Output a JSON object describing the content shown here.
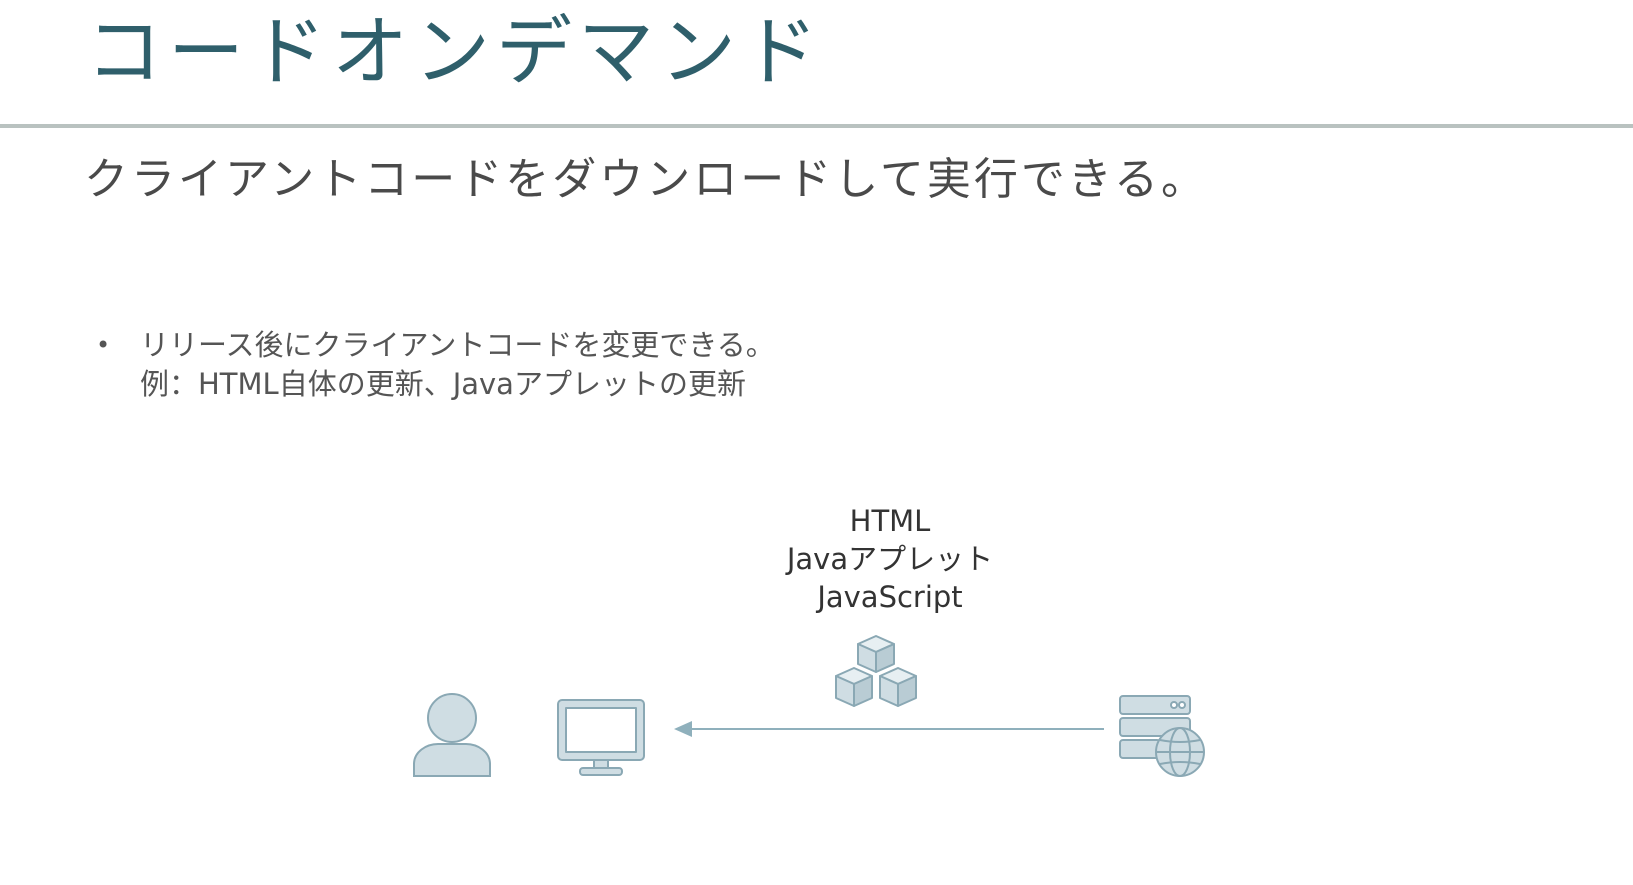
{
  "slide": {
    "title": "コードオンデマンド",
    "subtitle": "クライアントコードをダウンロードして実行できる。",
    "bullets": [
      {
        "line1": "リリース後にクライアントコードを変更できる。",
        "line2": "例：HTML自体の更新、Javaアプレットの更新"
      }
    ],
    "diagram": {
      "payload_labels": [
        "HTML",
        "Javaアプレット",
        "JavaScript"
      ],
      "icons": {
        "user": "user-icon",
        "client": "monitor-icon",
        "payload": "code-blocks-icon",
        "server": "web-server-icon"
      },
      "colors": {
        "icon_fill": "#cfdde3",
        "icon_stroke": "#8aa8b4",
        "arrow": "#8fb0bc"
      }
    }
  }
}
